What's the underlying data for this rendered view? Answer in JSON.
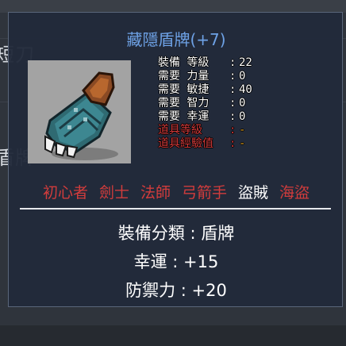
{
  "background_list": {
    "items": [
      "短刀",
      "盾牌"
    ]
  },
  "tooltip": {
    "title": "藏隱盾牌(+7)",
    "item_icon": "shield-bracer-icon",
    "stats": [
      {
        "label": "裝備 等級",
        "value": "22",
        "met": true
      },
      {
        "label": "需要 力量",
        "value": "0",
        "met": true
      },
      {
        "label": "需要 敏捷",
        "value": "40",
        "met": true
      },
      {
        "label": "需要 智力",
        "value": "0",
        "met": true
      },
      {
        "label": "需要 幸運",
        "value": "0",
        "met": true
      },
      {
        "label": "道具等級",
        "value": "-",
        "met": false
      },
      {
        "label": "道具經驗值",
        "value": "-",
        "met": false
      }
    ],
    "jobs": [
      {
        "label": "初心者",
        "enabled": false
      },
      {
        "label": "劍士",
        "enabled": false
      },
      {
        "label": "法師",
        "enabled": false
      },
      {
        "label": "弓箭手",
        "enabled": false
      },
      {
        "label": "盜賊",
        "enabled": true
      },
      {
        "label": "海盜",
        "enabled": false
      }
    ],
    "category": "裝備分類 : 盾牌",
    "luck": "幸運 : +15",
    "defense": "防禦力 : +20"
  },
  "colors": {
    "title": "#6ea2e6",
    "job_disabled": "#d23c3c",
    "job_enabled": "#ffffff",
    "unmet_label": "#d23a3a",
    "unmet_value": "#e0a020"
  }
}
